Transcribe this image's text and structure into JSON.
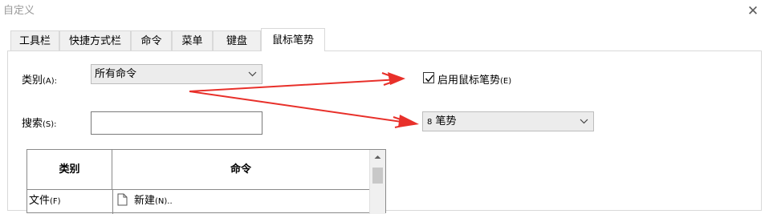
{
  "window": {
    "title": "自定义",
    "close_glyph": "✕"
  },
  "tabs": [
    {
      "label": "工具栏",
      "active": false
    },
    {
      "label": "快捷方式栏",
      "active": false
    },
    {
      "label": "命令",
      "active": false
    },
    {
      "label": "菜单",
      "active": false
    },
    {
      "label": "键盘",
      "active": false
    },
    {
      "label": "鼠标笔势",
      "active": true
    }
  ],
  "category": {
    "label": "类别",
    "accel": "(A):",
    "value": "所有命令"
  },
  "search": {
    "label": "搜索",
    "accel": "(S):",
    "value": ""
  },
  "gesture_toggle": {
    "label": "启用鼠标笔势",
    "accel": "(E)",
    "checked": true
  },
  "gesture_count": {
    "number": "8",
    "text": "笔势"
  },
  "table": {
    "headers": [
      "类别",
      "命令"
    ],
    "rows": [
      {
        "category": "文件",
        "category_accel": "(F)",
        "command": "新建",
        "command_accel": "(N).."
      }
    ]
  },
  "annotation_color": "#e8302a",
  "icons": {
    "close": "close-icon",
    "dropdown": "chevron-down-icon",
    "checkbox": "checkmark-icon",
    "document": "document-icon",
    "scroll_up": "scroll-up-arrow-icon"
  }
}
